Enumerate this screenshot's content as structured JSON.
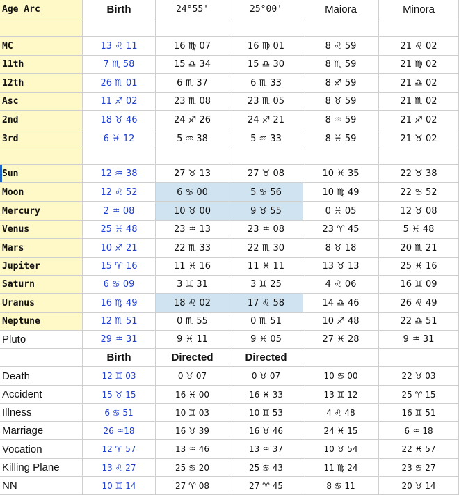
{
  "columns": [
    "Age Arc",
    "Birth",
    "24°55'",
    "25°00'",
    "Maiora",
    "Minora"
  ],
  "rows": [
    [
      "",
      "",
      "",
      "",
      "",
      ""
    ],
    [
      "MC",
      "13 ♌ 11",
      "16 ♍ 07",
      "16 ♍ 01",
      "8 ♌ 59",
      "21 ♌ 02"
    ],
    [
      "11th",
      "7 ♏ 58",
      "15 ♎ 34",
      "15 ♎ 30",
      "8 ♏ 59",
      "21 ♍ 02"
    ],
    [
      "12th",
      "26 ♏ 01",
      "6 ♏ 37",
      "6 ♏ 33",
      "8 ♐ 59",
      "21 ♎ 02"
    ],
    [
      "Asc",
      "11 ♐ 02",
      "23 ♏ 08",
      "23 ♏ 05",
      "8 ♉ 59",
      "21 ♏ 02"
    ],
    [
      "2nd",
      "18 ♉ 46",
      "24 ♐ 26",
      "24 ♐ 21",
      "8 ♒ 59",
      "21 ♐ 02"
    ],
    [
      "3rd",
      "6 ♓ 12",
      "5 ♒ 38",
      "5 ♒ 33",
      "8 ♓ 59",
      "21 ♉ 02"
    ],
    [
      "",
      "",
      "",
      "",
      "",
      ""
    ],
    [
      "Sun",
      "12 ♒ 38",
      "27 ♉ 13",
      "27 ♉ 08",
      "10 ♓ 35",
      "22 ♉ 38"
    ],
    [
      "Moon",
      "12 ♌ 52",
      "6 ♋ 00",
      "5 ♋ 56",
      "10 ♍ 49",
      "22 ♋ 52"
    ],
    [
      "Mercury",
      "2 ♒ 08",
      "10 ♉ 00",
      "9 ♉ 55",
      "0 ♓ 05",
      "12 ♉ 08"
    ],
    [
      "Venus",
      "25 ♓ 48",
      "23 ♒ 13",
      "23 ♒ 08",
      "23 ♈ 45",
      "5 ♓ 48"
    ],
    [
      "Mars",
      "10 ♐ 21",
      "22 ♏ 33",
      "22 ♏ 30",
      "8 ♉ 18",
      "20 ♏ 21"
    ],
    [
      "Jupiter",
      "15 ♈ 16",
      "11 ♓ 16",
      "11 ♓ 11",
      "13 ♉ 13",
      "25 ♓ 16"
    ],
    [
      "Saturn",
      "6 ♋ 09",
      "3 ♊ 31",
      "3 ♊ 25",
      "4 ♌ 06",
      "16 ♊ 09"
    ],
    [
      "Uranus",
      "16 ♍ 49",
      "18 ♌ 02",
      "17 ♌ 58",
      "14 ♎ 46",
      "26 ♌ 49"
    ],
    [
      "Neptune",
      "12 ♏ 51",
      "0 ♏ 55",
      "0 ♏ 51",
      "10 ♐ 48",
      "22 ♎ 51"
    ],
    [
      "Pluto",
      "29 ♒ 31",
      "9 ♓ 11",
      "9 ♓ 05",
      "27 ♓ 28",
      "9 ♒ 31"
    ],
    [
      "",
      "Birth",
      "Directed",
      "Directed",
      "",
      ""
    ],
    [
      "Death",
      "12 ♊ 03",
      "0 ♉ 07",
      "0 ♉ 07",
      "10 ♋ 00",
      "22 ♉ 03"
    ],
    [
      "Accident",
      "15 ♉ 15",
      "16 ♓ 00",
      "16 ♓ 33",
      "13 ♊ 12",
      "25 ♈ 15"
    ],
    [
      "Illness",
      "6 ♋ 51",
      "10 ♊ 03",
      "10 ♊ 53",
      "4 ♌ 48",
      "16 ♊ 51"
    ],
    [
      "Marriage",
      "26 ♒18",
      "16 ♉ 39",
      "16 ♉ 46",
      "24 ♓ 15",
      "6 ♒ 18"
    ],
    [
      "Vocation",
      "12 ♈ 57",
      "13 ♒ 46",
      "13 ♒ 37",
      "10 ♉ 54",
      "22 ♓ 57"
    ],
    [
      "Killing Plane",
      "13 ♌ 27",
      "25 ♋ 20",
      "25 ♋ 43",
      "11 ♍ 24",
      "23 ♋ 27"
    ],
    [
      "NN",
      "10 ♊ 14",
      "27 ♈ 08",
      "27 ♈ 45",
      "8 ♋ 11",
      "20 ♉ 14"
    ]
  ],
  "colors": {
    "label_bg": "#fff9c8",
    "highlight_bg": "#cfe3f1",
    "birth_text": "#1f3fd1",
    "grid": "#cfcfcf"
  }
}
